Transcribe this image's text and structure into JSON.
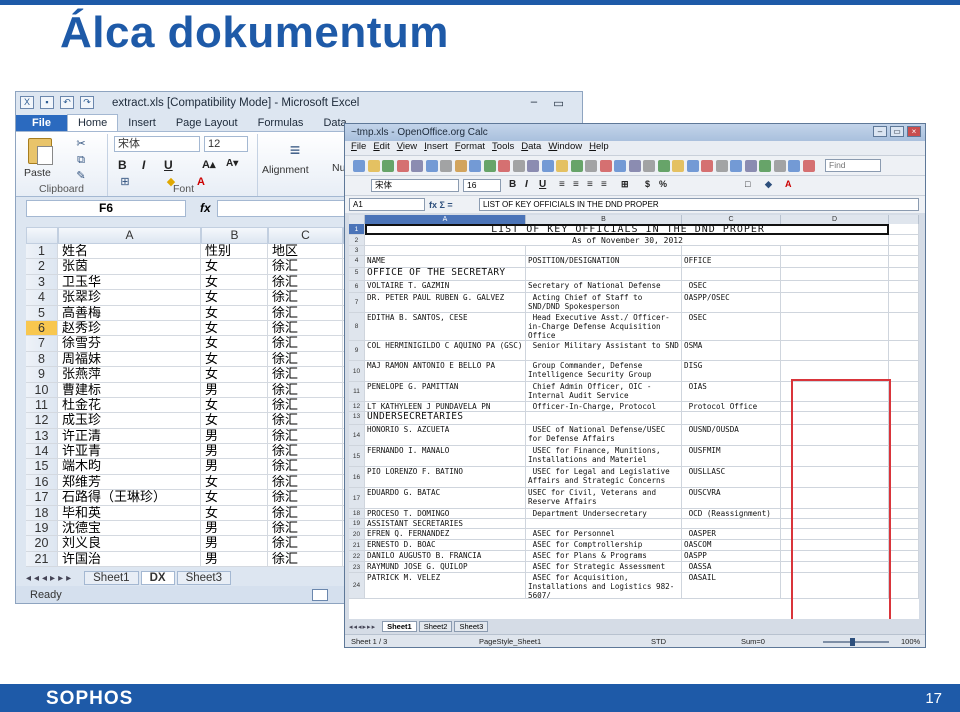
{
  "slide": {
    "title": "Álca dokumentum",
    "logo": "SOPHOS",
    "page_number": "17",
    "accent_color": "#1e5aa8"
  },
  "excel": {
    "window_title": "extract.xls [Compatibility Mode] - Microsoft Excel",
    "tabs": [
      "File",
      "Home",
      "Insert",
      "Page Layout",
      "Formulas",
      "Data"
    ],
    "active_tab": "Home",
    "ribbon": {
      "paste_label": "Paste",
      "clipboard_label": "Clipboard",
      "font_name": "宋体",
      "font_size": "12",
      "font_label": "Font",
      "alignment_label": "Alignment",
      "number_label": "Nur"
    },
    "name_box": "F6",
    "fx_label": "fx",
    "columns": [
      "A",
      "B",
      "C"
    ],
    "rows": [
      {
        "n": "1",
        "a": "姓名",
        "b": "性别",
        "c": "地区"
      },
      {
        "n": "2",
        "a": "张茵",
        "b": "女",
        "c": "徐汇"
      },
      {
        "n": "3",
        "a": "卫玉华",
        "b": "女",
        "c": "徐汇"
      },
      {
        "n": "4",
        "a": "张翠珍",
        "b": "女",
        "c": "徐汇"
      },
      {
        "n": "5",
        "a": "高善梅",
        "b": "女",
        "c": "徐汇"
      },
      {
        "n": "6",
        "a": "赵秀珍",
        "b": "女",
        "c": "徐汇"
      },
      {
        "n": "7",
        "a": "徐雪芬",
        "b": "女",
        "c": "徐汇"
      },
      {
        "n": "8",
        "a": "周福妹",
        "b": "女",
        "c": "徐汇"
      },
      {
        "n": "9",
        "a": "张燕萍",
        "b": "女",
        "c": "徐汇"
      },
      {
        "n": "10",
        "a": "曹建标",
        "b": "男",
        "c": "徐汇"
      },
      {
        "n": "11",
        "a": "杜金花",
        "b": "女",
        "c": "徐汇"
      },
      {
        "n": "12",
        "a": "成玉珍",
        "b": "女",
        "c": "徐汇"
      },
      {
        "n": "13",
        "a": "许正清",
        "b": "男",
        "c": "徐汇"
      },
      {
        "n": "14",
        "a": "许亚青",
        "b": "男",
        "c": "徐汇"
      },
      {
        "n": "15",
        "a": "端木昀",
        "b": "男",
        "c": "徐汇"
      },
      {
        "n": "16",
        "a": "郑维芳",
        "b": "女",
        "c": "徐汇"
      },
      {
        "n": "17",
        "a": "石路得（王琳珍）",
        "b": "女",
        "c": "徐汇"
      },
      {
        "n": "18",
        "a": "毕和英",
        "b": "女",
        "c": "徐汇"
      },
      {
        "n": "19",
        "a": "沈德宝",
        "b": "男",
        "c": "徐汇"
      },
      {
        "n": "20",
        "a": "刘义良",
        "b": "男",
        "c": "徐汇"
      },
      {
        "n": "21",
        "a": "许国治",
        "b": "男",
        "c": "徐汇"
      }
    ],
    "sheet_tabs": [
      "Sheet1",
      "DX",
      "Sheet3"
    ],
    "active_sheet": "DX",
    "status": "Ready"
  },
  "calc": {
    "window_title": "~tmp.xls - OpenOffice.org Calc",
    "menu": [
      "File",
      "Edit",
      "View",
      "Insert",
      "Format",
      "Tools",
      "Data",
      "Window",
      "Help"
    ],
    "find_placeholder": "Find",
    "font_name": "宋体",
    "font_size": "16",
    "cell_ref": "A1",
    "cell_content": "LIST OF KEY OFFICIALS IN THE DND PROPER",
    "columns": [
      "A",
      "B",
      "C",
      "D"
    ],
    "title": "LIST OF KEY OFFICIALS IN THE DND PROPER",
    "subtitle": "As of November 30, 2012",
    "headers": {
      "name": "NAME",
      "position": "POSITION/DESIGNATION",
      "office": "OFFICE"
    },
    "section1": "OFFICE OF THE SECRETARY",
    "section2": "UNDERSECRETARIES",
    "section3": "ASSISTANT SECRETARIES",
    "rows": [
      {
        "n": "6",
        "name": "VOLTAIRE T. GAZMIN",
        "pos": "Secretary of National Defense",
        "office": " OSEC",
        "h": 12
      },
      {
        "n": "7",
        "name": "DR. PETER PAUL RUBEN G. GALVEZ",
        "pos": " Acting Chief of Staff to\nSND/DND Spokesperson",
        "office": "OASPP/OSEC",
        "h": 20
      },
      {
        "n": "8",
        "name": "EDITHA B. SANTOS, CESE",
        "pos": " Head Executive Asst./ Officer-\nin-Charge Defense Acquisition\nOffice",
        "office": " OSEC",
        "h": 28
      },
      {
        "n": "9",
        "name": "COL HERMINIGILDO C AQUINO PA (GSC)",
        "pos": " Senior Military Assistant to SND",
        "office": "OSMA",
        "h": 20
      },
      {
        "n": "10",
        "name": "MAJ RAMON ANTONIO E BELLO PA",
        "pos": " Group Commander, Defense\nIntelligence Security Group",
        "office": "DISG",
        "h": 21
      },
      {
        "n": "11",
        "name": "PENELOPE G. PAMITTAN",
        "pos": " Chief Admin Officer, OIC -\nInternal Audit Service",
        "office": " OIAS",
        "h": 20
      },
      {
        "n": "12",
        "name": "LT KATHYLEEN J PUNDAVELA PN",
        "pos": " Officer-In-Charge, Protocol",
        "office": " Protocol Office",
        "h": 10
      }
    ],
    "rows2": [
      {
        "n": "14",
        "name": "HONORIO S. AZCUETA",
        "pos": " USEC of National Defense/USEC\nfor Defense Affairs",
        "office": " OUSND/OUSDA",
        "h": 21
      },
      {
        "n": "15",
        "name": "FERNANDO I. MANALO",
        "pos": " USEC for Finance, Munitions,\nInstallations and Materiel",
        "office": " OUSFMIM",
        "h": 21
      },
      {
        "n": "16",
        "name": "PIO LORENZO F. BATINO",
        "pos": " USEC for Legal and Legislative\nAffairs and Strategic Concerns",
        "office": " OUSLLASC",
        "h": 21
      },
      {
        "n": "17",
        "name": "EDUARDO G. BATAC",
        "pos": "USEC for Civil, Veterans and\nReserve Affairs",
        "office": " OUSCVRA",
        "h": 21
      },
      {
        "n": "18",
        "name": "PROCESO T. DOMINGO",
        "pos": " Department Undersecretary",
        "office": " OCD (Reassignment)",
        "h": 10
      }
    ],
    "rows3": [
      {
        "n": "20",
        "name": "EFREN Q. FERNANDEZ",
        "pos": " ASEC for Personnel",
        "office": " OASPER",
        "h": 11
      },
      {
        "n": "21",
        "name": "ERNESTO D. BOAC",
        "pos": " ASEC for Comptrollership",
        "office": "OASCOM",
        "h": 11
      },
      {
        "n": "22",
        "name": "DANILO AUGUSTO B. FRANCIA",
        "pos": " ASEC for Plans & Programs",
        "office": "OASPP",
        "h": 11
      },
      {
        "n": "23",
        "name": "RAYMUND JOSE G. QUILOP",
        "pos": " ASEC for Strategic Assessment",
        "office": " OASSA",
        "h": 11
      },
      {
        "n": "24",
        "name": "PATRICK M. VELEZ",
        "pos": " ASEC for Acquisition,\nInstallations and Logistics 982-\n5607/",
        "office": " OASAIL",
        "h": 26
      }
    ],
    "sheet_tabs": [
      "Sheet1",
      "Sheet2",
      "Sheet3"
    ],
    "status": {
      "sheet": "Sheet 1 / 3",
      "style": "PageStyle_Sheet1",
      "mode": "STD",
      "sum": "Sum=0",
      "zoom": "100%"
    }
  }
}
